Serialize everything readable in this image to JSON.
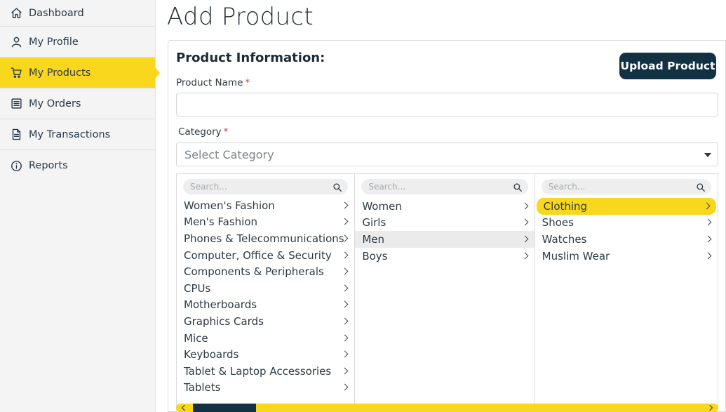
{
  "sidebar": {
    "items": [
      {
        "label": "Dashboard",
        "icon": "home-icon"
      },
      {
        "label": "My Profile",
        "icon": "user-icon"
      },
      {
        "label": "My Products",
        "icon": "cart-icon",
        "active": true
      },
      {
        "label": "My Orders",
        "icon": "list-icon"
      },
      {
        "label": "My Transactions",
        "icon": "document-icon"
      },
      {
        "label": "Reports",
        "icon": "info-icon"
      }
    ]
  },
  "page": {
    "title": "Add Product"
  },
  "form": {
    "section_title": "Product Information:",
    "upload_button": "Upload Product",
    "product_name_label": "Product Name",
    "category_label": "Category",
    "required_mark": "*",
    "product_name_value": "",
    "category_placeholder": "Select Category"
  },
  "picker": {
    "search_placeholder": "Search...",
    "col1": [
      "Women's Fashion",
      "Men's Fashion",
      "Phones & Telecommunications",
      "Computer, Office & Security",
      "Components & Peripherals",
      "CPUs",
      "Motherboards",
      "Graphics Cards",
      "Mice",
      "Keyboards",
      "Tablet & Laptop Accessories",
      "Tablets"
    ],
    "col2": [
      "Women",
      "Girls",
      "Men",
      "Boys"
    ],
    "col3": [
      "Clothing",
      "Shoes",
      "Watches",
      "Muslim Wear"
    ],
    "col2_selected": "Men",
    "col3_selected": "Clothing"
  },
  "colors": {
    "accent": "#f9d71c",
    "button": "#123244",
    "required": "#d63b3b"
  }
}
